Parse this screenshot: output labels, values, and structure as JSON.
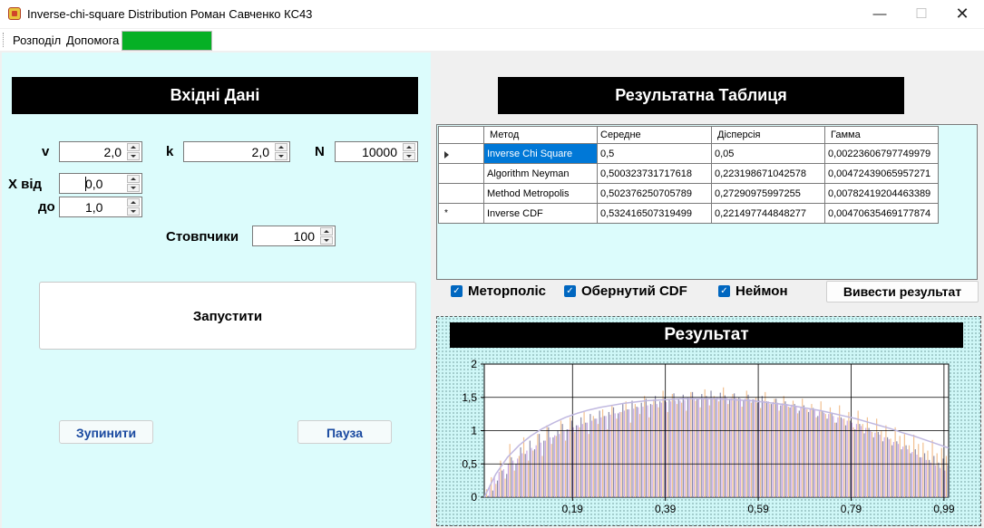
{
  "window": {
    "title": "Inverse-chi-square Distribution Роман Савченко КС43",
    "minimize": "—",
    "maximize": "☐",
    "close": "✕"
  },
  "menu": {
    "items": [
      "Розподіл",
      "Допомога"
    ],
    "progress": 1.0,
    "progress_color": "#06b025"
  },
  "input": {
    "header": "Вхідні Дані",
    "v_label": "v",
    "v_value": "2,0",
    "k_label": "k",
    "k_value": "2,0",
    "n_label": "N",
    "n_value": "10000",
    "x_from_label": "X від",
    "x_from_value": "0,0",
    "x_to_label": "до",
    "x_to_value": "1,0",
    "bins_label": "Стовпчики",
    "bins_value": "100",
    "run_button": "Запустити",
    "stop_button": "Зупинити",
    "pause_button": "Пауза"
  },
  "results": {
    "header": "Результатна Таблиця",
    "columns": [
      "Метод",
      "Середне",
      "Дісперсія",
      "Гамма"
    ],
    "rows": [
      [
        "Inverse Chi Square",
        "0,5",
        "0,05",
        "0,00223606797749979"
      ],
      [
        "Algorithm Neyman",
        "0,500323731717618",
        "0,223198671042578",
        "0,00472439065957271"
      ],
      [
        "Method Metropolis",
        "0,502376250705789",
        "0,27290975997255",
        "0,00782419204463389"
      ],
      [
        "Inverse CDF",
        "0,532416507319499",
        "0,221497744848277",
        "0,00470635469177874"
      ]
    ],
    "selected_row": 0,
    "new_row_marker": "*"
  },
  "options": {
    "metropolis": {
      "label": "Меторполіс",
      "checked": true
    },
    "inverted_cdf": {
      "label": "Обернутий CDF",
      "checked": true
    },
    "neyman": {
      "label": "Неймон",
      "checked": true
    },
    "output_button": "Вивести результат"
  },
  "chart_data": {
    "type": "bar",
    "title": "Результат",
    "xlabel": "",
    "ylabel": "",
    "ylim": [
      0,
      2
    ],
    "xlim": [
      0.0,
      1.0
    ],
    "yticks": [
      "0",
      "0,5",
      "1",
      "1,5",
      "2"
    ],
    "xticks": [
      "0,19",
      "0,39",
      "0,59",
      "0,79",
      "0,99"
    ],
    "xtick_values": [
      0.19,
      0.39,
      0.59,
      0.79,
      0.99
    ],
    "grid": true,
    "bins": 100,
    "series": [
      {
        "color": "#c8a8e8",
        "values": [
          0.05,
          0.18,
          0.32,
          0.38,
          0.42,
          0.5,
          0.55,
          0.58,
          0.66,
          0.7,
          0.74,
          0.78,
          0.82,
          0.85,
          0.9,
          0.93,
          0.95,
          1.0,
          1.02,
          1.05,
          1.08,
          1.1,
          1.12,
          1.15,
          1.18,
          1.2,
          1.22,
          1.24,
          1.26,
          1.28,
          1.3,
          1.32,
          1.33,
          1.35,
          1.36,
          1.38,
          1.39,
          1.4,
          1.42,
          1.43,
          1.44,
          1.45,
          1.45,
          1.46,
          1.47,
          1.47,
          1.48,
          1.48,
          1.49,
          1.49,
          1.5,
          1.5,
          1.5,
          1.49,
          1.49,
          1.48,
          1.48,
          1.47,
          1.47,
          1.46,
          1.45,
          1.44,
          1.43,
          1.42,
          1.41,
          1.4,
          1.39,
          1.37,
          1.36,
          1.34,
          1.33,
          1.31,
          1.29,
          1.27,
          1.25,
          1.22,
          1.2,
          1.18,
          1.15,
          1.12,
          1.1,
          1.07,
          1.04,
          1.0,
          0.97,
          0.94,
          0.9,
          0.87,
          0.83,
          0.8,
          0.76,
          0.72,
          0.68,
          0.64,
          0.6,
          0.56,
          0.52,
          0.48,
          0.44,
          0.4
        ]
      },
      {
        "color": "#f2c090",
        "values": [
          0.12,
          0.3,
          0.2,
          0.55,
          0.28,
          0.8,
          0.4,
          0.62,
          0.9,
          0.55,
          0.7,
          0.95,
          0.62,
          1.08,
          0.8,
          0.92,
          1.15,
          0.85,
          1.2,
          0.98,
          1.05,
          1.28,
          0.95,
          1.22,
          1.1,
          1.32,
          1.02,
          1.38,
          1.18,
          1.28,
          1.44,
          1.12,
          1.4,
          1.25,
          1.52,
          1.2,
          1.47,
          1.35,
          1.6,
          1.28,
          1.55,
          1.4,
          1.42,
          1.3,
          1.58,
          1.45,
          1.35,
          1.62,
          1.38,
          1.52,
          1.44,
          1.65,
          1.4,
          1.55,
          1.48,
          1.36,
          1.6,
          1.42,
          1.5,
          1.34,
          1.58,
          1.4,
          1.48,
          1.3,
          1.52,
          1.36,
          1.45,
          1.26,
          1.48,
          1.32,
          1.4,
          1.2,
          1.44,
          1.25,
          1.35,
          1.12,
          1.38,
          1.18,
          1.28,
          1.05,
          1.3,
          1.1,
          1.2,
          0.98,
          1.18,
          1.0,
          1.08,
          0.88,
          1.05,
          0.92,
          0.95,
          0.78,
          0.94,
          0.8,
          0.82,
          0.7,
          0.86,
          0.66,
          0.74,
          0.62
        ]
      },
      {
        "color": "#8a8aa8",
        "values": [
          0.02,
          0.1,
          0.25,
          0.4,
          0.35,
          0.6,
          0.5,
          0.75,
          0.65,
          0.85,
          0.72,
          0.95,
          0.85,
          1.05,
          0.9,
          1.0,
          1.1,
          1.02,
          1.15,
          1.08,
          1.2,
          1.12,
          1.25,
          1.18,
          1.3,
          1.22,
          1.28,
          1.35,
          1.26,
          1.4,
          1.32,
          1.45,
          1.36,
          1.42,
          1.48,
          1.4,
          1.52,
          1.44,
          1.5,
          1.46,
          1.56,
          1.48,
          1.54,
          1.5,
          1.58,
          1.47,
          1.55,
          1.52,
          1.6,
          1.49,
          1.57,
          1.53,
          1.48,
          1.56,
          1.5,
          1.45,
          1.54,
          1.47,
          1.42,
          1.52,
          1.44,
          1.4,
          1.48,
          1.38,
          1.44,
          1.35,
          1.4,
          1.3,
          1.38,
          1.28,
          1.34,
          1.22,
          1.3,
          1.18,
          1.26,
          1.12,
          1.2,
          1.08,
          1.15,
          1.02,
          1.1,
          0.96,
          1.04,
          0.9,
          0.98,
          0.84,
          0.9,
          0.78,
          0.84,
          0.72,
          0.78,
          0.66,
          0.72,
          0.6,
          0.66,
          0.56,
          0.62,
          0.52,
          0.58,
          0.48
        ]
      }
    ],
    "curve": {
      "color": "#c0b8e0",
      "values": [
        0.0,
        0.35,
        0.6,
        0.78,
        0.92,
        1.03,
        1.12,
        1.2,
        1.26,
        1.31,
        1.35,
        1.38,
        1.41,
        1.43,
        1.45,
        1.46,
        1.47,
        1.48,
        1.48,
        1.48,
        1.48,
        1.47,
        1.46,
        1.45,
        1.43,
        1.41,
        1.39,
        1.36,
        1.33,
        1.3,
        1.26,
        1.22,
        1.18,
        1.13,
        1.08,
        1.03,
        0.97,
        0.92,
        0.86,
        0.8,
        0.74
      ]
    }
  }
}
